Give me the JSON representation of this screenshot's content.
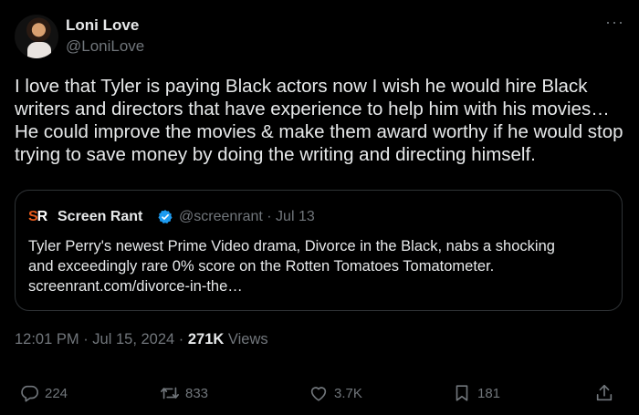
{
  "author": {
    "name": "Loni Love",
    "handle": "@LoniLove"
  },
  "tweet_text": "I love that Tyler is paying Black actors now I wish he would hire Black writers and directors that have experience to help him with his movies… He could improve the movies & make them award worthy if he would stop trying to save money by doing the writing and directing himself.",
  "quote": {
    "logo_text": "SR",
    "name": "Screen Rant",
    "handle_date": "@screenrant · Jul 13",
    "text_line1": "Tyler Perry's newest Prime Video drama, Divorce in the Black, nabs a shocking",
    "text_line2": "and exceedingly rare 0% score on the Rotten Tomatoes Tomatometer.",
    "link": "screenrant.com/divorce-in-the…"
  },
  "meta": {
    "timestamp": "12:01 PM · Jul 15, 2024 · ",
    "views_count": "271K",
    "views_label": " Views"
  },
  "actions": {
    "replies": "224",
    "reposts": "833",
    "likes": "3.7K",
    "bookmarks": "181"
  },
  "icons": [
    "more-icon",
    "verified-icon",
    "reply-icon",
    "repost-icon",
    "like-icon",
    "bookmark-icon",
    "share-icon"
  ],
  "colors": {
    "background": "#000000",
    "text": "#e7e9ea",
    "muted": "#71767b",
    "verified": "#1d9bf0",
    "border": "#2f3336"
  }
}
